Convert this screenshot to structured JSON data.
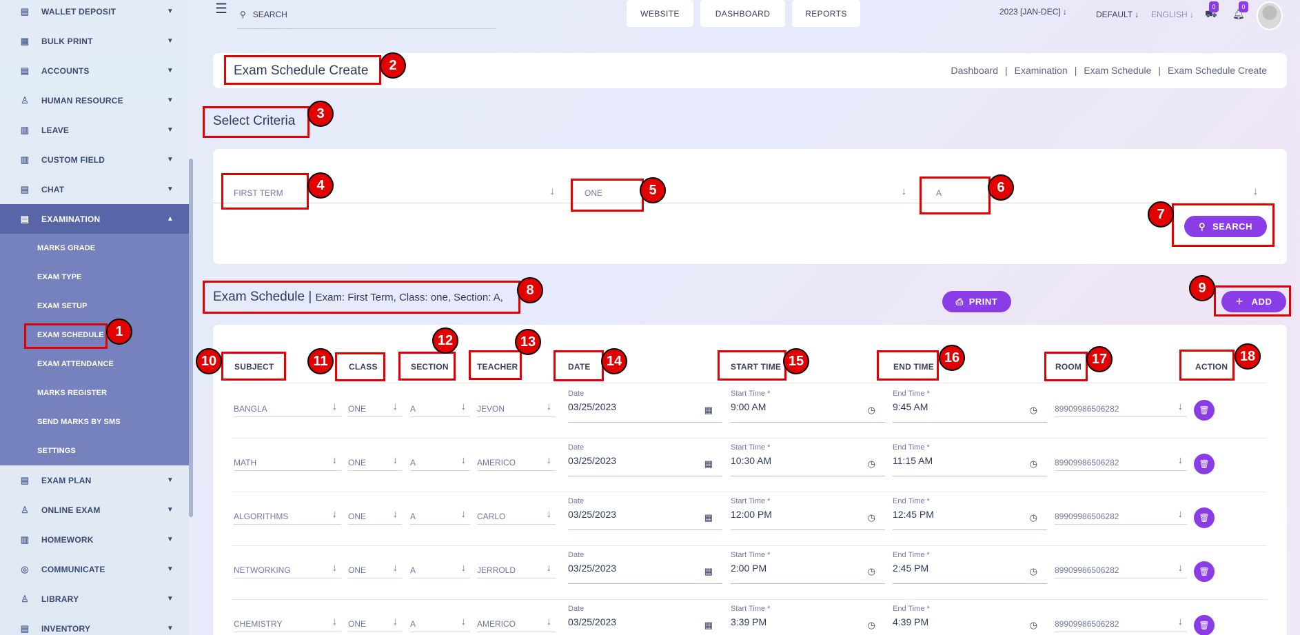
{
  "sidebar": {
    "items": [
      {
        "label": "WALLET DEPOSIT",
        "icon": "wallet-icon"
      },
      {
        "label": "BULK PRINT",
        "icon": "print-icon"
      },
      {
        "label": "ACCOUNTS",
        "icon": "accounts-icon"
      },
      {
        "label": "HUMAN RESOURCE",
        "icon": "human-resource-icon"
      },
      {
        "label": "LEAVE",
        "icon": "leave-icon"
      },
      {
        "label": "CUSTOM FIELD",
        "icon": "custom-field-icon"
      },
      {
        "label": "CHAT",
        "icon": "chat-icon"
      },
      {
        "label": "EXAMINATION",
        "icon": "examination-icon"
      }
    ],
    "submenu": [
      {
        "label": "MARKS GRADE"
      },
      {
        "label": "EXAM TYPE"
      },
      {
        "label": "EXAM SETUP"
      },
      {
        "label": "EXAM SCHEDULE"
      },
      {
        "label": "EXAM ATTENDANCE"
      },
      {
        "label": "MARKS REGISTER"
      },
      {
        "label": "SEND MARKS BY SMS"
      },
      {
        "label": "SETTINGS"
      }
    ],
    "items_after": [
      {
        "label": "EXAM PLAN",
        "icon": "exam-plan-icon"
      },
      {
        "label": "ONLINE EXAM",
        "icon": "online-exam-icon"
      },
      {
        "label": "HOMEWORK",
        "icon": "homework-icon"
      },
      {
        "label": "COMMUNICATE",
        "icon": "communicate-icon"
      },
      {
        "label": "LIBRARY",
        "icon": "library-icon"
      },
      {
        "label": "INVENTORY",
        "icon": "inventory-icon"
      }
    ]
  },
  "topbar": {
    "search_placeholder": "SEARCH",
    "buttons": [
      "WEBSITE",
      "DASHBOARD",
      "REPORTS"
    ],
    "session": "2023 [JAN-DEC]",
    "style": "DEFAULT",
    "language": "ENGLISH",
    "cart_count": "0",
    "notification_count": "0"
  },
  "header": {
    "title": "Exam Schedule Create",
    "breadcrumb": [
      "Dashboard",
      "Examination",
      "Exam Schedule",
      "Exam Schedule Create"
    ],
    "separator": "|"
  },
  "criteria": {
    "title": "Select Criteria",
    "exam": "FIRST TERM",
    "class": "ONE",
    "section": "A",
    "search_label": "SEARCH"
  },
  "schedule": {
    "title": "Exam Schedule |",
    "subtitle": "Exam: First Term, Class: one, Section: A,",
    "print_label": "PRINT",
    "add_label": "ADD",
    "columns": [
      "SUBJECT",
      "CLASS",
      "SECTION",
      "TEACHER",
      "DATE",
      "START TIME",
      "END TIME",
      "ROOM",
      "ACTION"
    ],
    "date_label": "Date",
    "start_label": "Start Time *",
    "end_label": "End Time *",
    "rows": [
      {
        "subject": "BANGLA",
        "class": "ONE",
        "section": "A",
        "teacher": "JEVON",
        "date": "03/25/2023",
        "start": "9:00 AM",
        "end": "9:45 AM",
        "room": "89909986506282"
      },
      {
        "subject": "MATH",
        "class": "ONE",
        "section": "A",
        "teacher": "AMERICO",
        "date": "03/25/2023",
        "start": "10:30 AM",
        "end": "11:15 AM",
        "room": "89909986506282"
      },
      {
        "subject": "ALGORITHMS",
        "class": "ONE",
        "section": "A",
        "teacher": "CARLO",
        "date": "03/25/2023",
        "start": "12:00 PM",
        "end": "12:45 PM",
        "room": "89909986506282"
      },
      {
        "subject": "NETWORKING",
        "class": "ONE",
        "section": "A",
        "teacher": "JERROLD",
        "date": "03/25/2023",
        "start": "2:00 PM",
        "end": "2:45 PM",
        "room": "89909986506282"
      },
      {
        "subject": "CHEMISTRY",
        "class": "ONE",
        "section": "A",
        "teacher": "AMERICO",
        "date": "03/25/2023",
        "start": "3:39 PM",
        "end": "4:39 PM",
        "room": "89909986506282"
      }
    ]
  },
  "annotations": [
    "1",
    "2",
    "3",
    "4",
    "5",
    "6",
    "7",
    "8",
    "9",
    "10",
    "11",
    "12",
    "13",
    "14",
    "15",
    "16",
    "17",
    "18"
  ],
  "colors": {
    "accent": "#8a3de6",
    "sidebar_active": "#5866a8",
    "submenu_bg": "#7682bd",
    "annotation": "#e30000"
  }
}
